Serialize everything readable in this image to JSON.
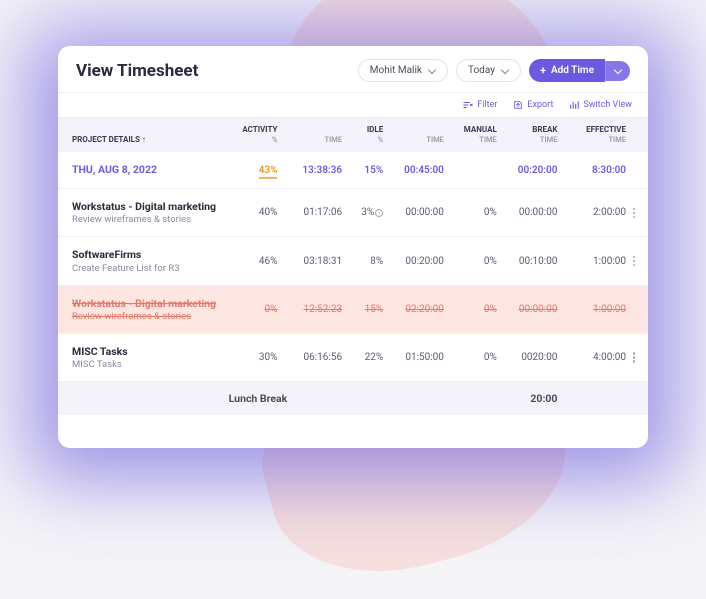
{
  "header": {
    "title": "View Timesheet",
    "user": "Mohit Malik",
    "range": "Today",
    "addLabel": "Add Time"
  },
  "toolbar": {
    "filter": "Filter",
    "export": "Export",
    "switchView": "Switch View"
  },
  "columns": {
    "project": "PROJECT DETAILS ↑",
    "activity": "ACTIVITY",
    "idle": "IDLE",
    "manual": "MANUAL",
    "break": "BREAK",
    "effective": "EFFECTIVE",
    "pct": "%",
    "time": "TIME"
  },
  "summary": {
    "date": "THU, AUG 8, 2022",
    "activityPct": "43%",
    "activityTime": "13:38:36",
    "idlePct": "15%",
    "idleTime": "00:45:00",
    "manual": "",
    "break": "00:20:00",
    "effective": "8:30:00"
  },
  "rows": [
    {
      "project": "Workstatus - Digital marketing",
      "task": "Review wireframes & stories",
      "activityPct": "40%",
      "activityTime": "01:17:06",
      "idlePct": "3%",
      "idleTime": "00:00:00",
      "manual": "0%",
      "break": "00:00:00",
      "effective": "2:00:00"
    },
    {
      "project": "SoftwareFirms",
      "task": "Create Feature List for R3",
      "activityPct": "46%",
      "activityTime": "03:18:31",
      "idlePct": "8%",
      "idleTime": "00:20:00",
      "manual": "0%",
      "break": "00:10:00",
      "effective": "1:00:00"
    },
    {
      "project": "Workstatus - Digital marketing",
      "task": "Review wireframes & stories",
      "activityPct": "0%",
      "activityTime": "12:52:23",
      "idlePct": "15%",
      "idleTime": "02:20:00",
      "manual": "0%",
      "break": "00:00:00",
      "effective": "1:00:00"
    },
    {
      "project": "MISC Tasks",
      "task": "MISC Tasks",
      "activityPct": "30%",
      "activityTime": "06:16:56",
      "idlePct": "22%",
      "idleTime": "01:50:00",
      "manual": "0%",
      "break": "0020:00",
      "effective": "4:00:00"
    }
  ],
  "footer": {
    "label": "Lunch Break",
    "value": "20:00"
  }
}
